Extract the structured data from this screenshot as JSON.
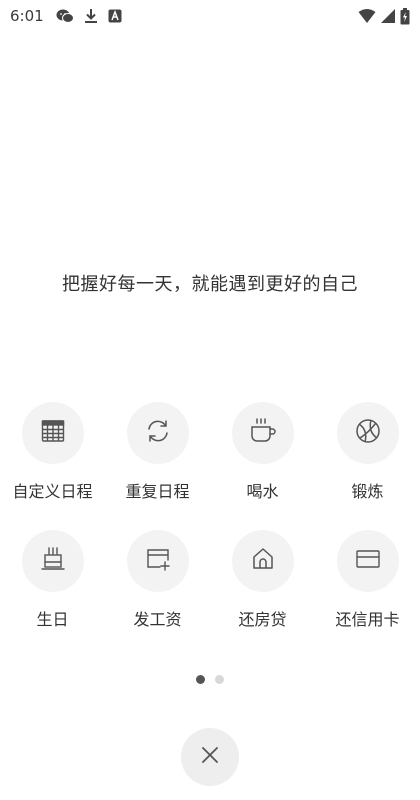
{
  "status_bar": {
    "time": "6:01",
    "icons": [
      "wechat-icon",
      "download-icon",
      "a-badge-icon",
      "wifi-icon",
      "signal-icon",
      "battery-icon"
    ]
  },
  "slogan": "把握好每一天，就能遇到更好的自己",
  "grid": {
    "items": [
      {
        "label": "自定义日程",
        "icon": "calendar-grid-icon"
      },
      {
        "label": "重复日程",
        "icon": "repeat-icon"
      },
      {
        "label": "喝水",
        "icon": "cup-icon"
      },
      {
        "label": "锻炼",
        "icon": "basketball-icon"
      },
      {
        "label": "生日",
        "icon": "cake-icon"
      },
      {
        "label": "发工资",
        "icon": "card-plus-icon"
      },
      {
        "label": "还房贷",
        "icon": "house-icon"
      },
      {
        "label": "还信用卡",
        "icon": "credit-card-icon"
      }
    ]
  },
  "pager": {
    "count": 2,
    "active": 0
  },
  "colors": {
    "icon_stroke": "#555555",
    "tile_bg": "#f3f3f3",
    "dot_active": "#555555",
    "dot_inactive": "#d8d8d8"
  }
}
